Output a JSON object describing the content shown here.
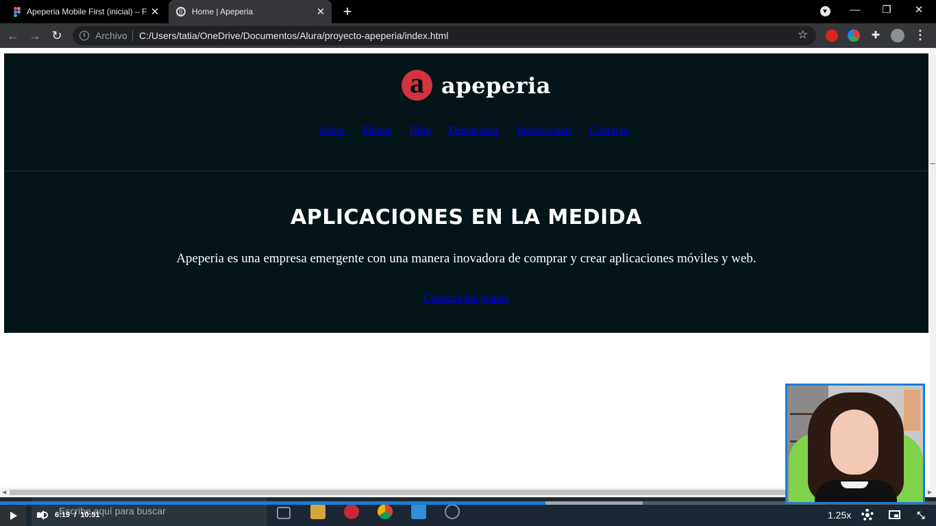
{
  "browser": {
    "tabs": [
      {
        "title": "Apeperia Mobile First (inicial) – F",
        "icon": "figma-icon",
        "close": "✕"
      },
      {
        "title": "Home | Apeperia",
        "icon": "globe-icon",
        "close": "✕"
      }
    ],
    "new_tab": "+",
    "window_controls": {
      "minimize": "—",
      "restore": "❐",
      "close": "✕"
    },
    "toolbar": {
      "back": "←",
      "forward": "→",
      "reload": "↻",
      "security_label": "Archivo",
      "url": "C:/Users/tatia/OneDrive/Documentos/Alura/proyecto-apeperia/index.html",
      "bookmark": "☆",
      "menu": "⋮"
    }
  },
  "site": {
    "logo_letter": "a",
    "logo_text": "apeperia",
    "nav": [
      "Sobre",
      "Planos",
      "Blog",
      "Destacados",
      "Institucional",
      "Contacto"
    ],
    "hero_title": "APLICACIONES EN LA MEDIDA",
    "hero_text": "Apeperia es una empresa emergente con una manera inovadora de comprar y crear aplicaciones móviles y web.",
    "hero_link": "Conozca los planos"
  },
  "taskbar": {
    "search_placeholder": "Escribe aquí para buscar"
  },
  "player": {
    "current_time": "6:19",
    "separator": "/",
    "duration": "10:51",
    "speed": "1.25x",
    "progress_fraction": 0.583,
    "buffered_fraction": 0.687,
    "accent": "#1c7cd6"
  },
  "colors": {
    "site_bg": "#041519",
    "logo_red": "#d1343f",
    "link": "#0000ee"
  }
}
